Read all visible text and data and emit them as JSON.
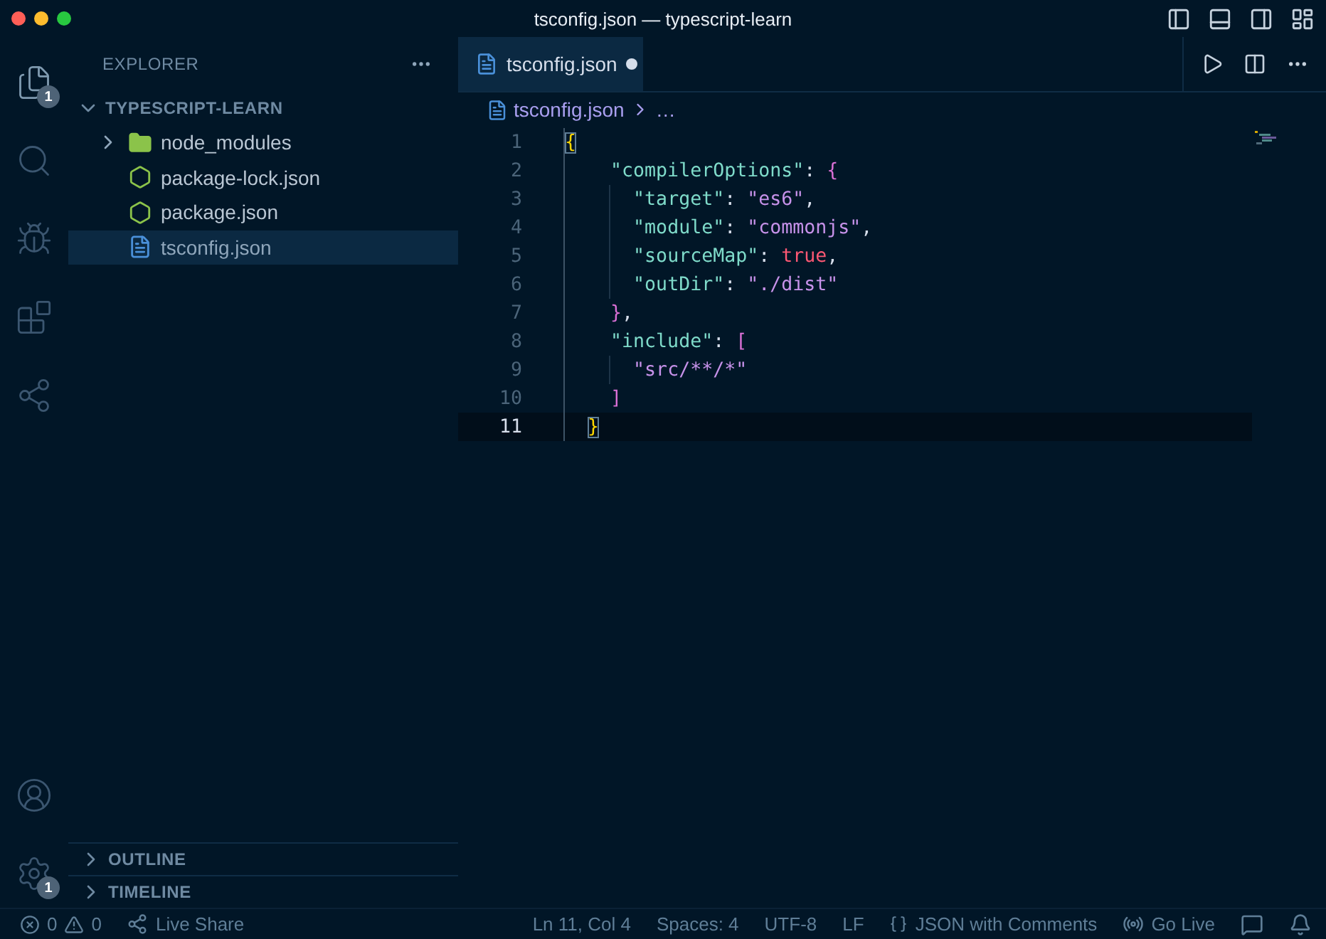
{
  "window": {
    "title": "tsconfig.json — typescript-learn"
  },
  "activity_bar": {
    "items": [
      {
        "kind": "files",
        "selected": true,
        "badge": "1"
      },
      {
        "kind": "search",
        "selected": false
      },
      {
        "kind": "debug",
        "selected": false
      },
      {
        "kind": "extensions",
        "selected": false
      },
      {
        "kind": "live-share",
        "selected": false
      }
    ],
    "bottom": [
      {
        "kind": "account"
      },
      {
        "kind": "settings",
        "badge": "1"
      }
    ]
  },
  "sidebar": {
    "title": "EXPLORER",
    "tree": {
      "label": "TYPESCRIPT-LEARN",
      "expanded": true,
      "children": [
        {
          "label": "node_modules",
          "kind": "folder",
          "expanded": false,
          "selected": false
        },
        {
          "label": "package-lock.json",
          "kind": "js",
          "selected": false
        },
        {
          "label": "package.json",
          "kind": "js",
          "selected": false
        },
        {
          "label": "tsconfig.json",
          "kind": "ts",
          "selected": true
        }
      ]
    },
    "sections": [
      {
        "label": "OUTLINE",
        "expanded": false
      },
      {
        "label": "TIMELINE",
        "expanded": false
      }
    ]
  },
  "tabs": [
    {
      "label": "tsconfig.json",
      "selected": true,
      "modified": true
    }
  ],
  "breadcrumb": [
    "tsconfig.json",
    "…"
  ],
  "editor": {
    "lines": [
      {
        "number": "1",
        "current": false,
        "tokens": [
          {
            "text": "{",
            "kind": "brace",
            "matched": true
          }
        ]
      },
      {
        "number": "2",
        "current": false,
        "tokens": [
          {
            "text": "    \"compilerOptions\"",
            "kind": "key"
          },
          {
            "text": ": ",
            "kind": "punct"
          },
          {
            "text": "{",
            "kind": "bracket"
          }
        ]
      },
      {
        "number": "3",
        "current": false,
        "tokens": [
          {
            "text": "      \"target\"",
            "kind": "key"
          },
          {
            "text": ": ",
            "kind": "punct"
          },
          {
            "text": "\"es6\"",
            "kind": "string"
          },
          {
            "text": ",",
            "kind": "punct"
          }
        ]
      },
      {
        "number": "4",
        "current": false,
        "tokens": [
          {
            "text": "      \"module\"",
            "kind": "key"
          },
          {
            "text": ": ",
            "kind": "punct"
          },
          {
            "text": "\"commonjs\"",
            "kind": "string"
          },
          {
            "text": ",",
            "kind": "punct"
          }
        ]
      },
      {
        "number": "5",
        "current": false,
        "tokens": [
          {
            "text": "      \"sourceMap\"",
            "kind": "key"
          },
          {
            "text": ": ",
            "kind": "punct"
          },
          {
            "text": "true",
            "kind": "boolean"
          },
          {
            "text": ",",
            "kind": "punct"
          }
        ]
      },
      {
        "number": "6",
        "current": false,
        "tokens": [
          {
            "text": "      \"outDir\"",
            "kind": "key"
          },
          {
            "text": ": ",
            "kind": "punct"
          },
          {
            "text": "\"./dist\"",
            "kind": "string"
          }
        ]
      },
      {
        "number": "7",
        "current": false,
        "tokens": [
          {
            "text": "    }",
            "kind": "bracket"
          },
          {
            "text": ",",
            "kind": "punct"
          }
        ]
      },
      {
        "number": "8",
        "current": false,
        "tokens": [
          {
            "text": "    \"include\"",
            "kind": "key"
          },
          {
            "text": ": ",
            "kind": "punct"
          },
          {
            "text": "[",
            "kind": "bracket"
          }
        ]
      },
      {
        "number": "9",
        "current": false,
        "tokens": [
          {
            "text": "      \"src/**/*\"",
            "kind": "string"
          }
        ]
      },
      {
        "number": "10",
        "current": false,
        "tokens": [
          {
            "text": "    ]",
            "kind": "bracket"
          }
        ]
      },
      {
        "number": "11",
        "current": true,
        "tokens": [
          {
            "text": "  }",
            "kind": "brace",
            "matched": true
          }
        ]
      }
    ]
  },
  "status_bar": {
    "errors": "0",
    "warnings": "0",
    "left": [
      {
        "kind": "live-share",
        "text": "Live Share"
      }
    ],
    "right": [
      {
        "kind": "text",
        "text": "Ln 11, Col 4"
      },
      {
        "kind": "text",
        "text": "Spaces: 4"
      },
      {
        "kind": "text",
        "text": "UTF-8"
      },
      {
        "kind": "text",
        "text": "LF"
      },
      {
        "kind": "language",
        "text": "JSON with Comments"
      },
      {
        "kind": "go-live",
        "text": "Go Live"
      },
      {
        "kind": "feedback"
      },
      {
        "kind": "bell"
      }
    ]
  }
}
